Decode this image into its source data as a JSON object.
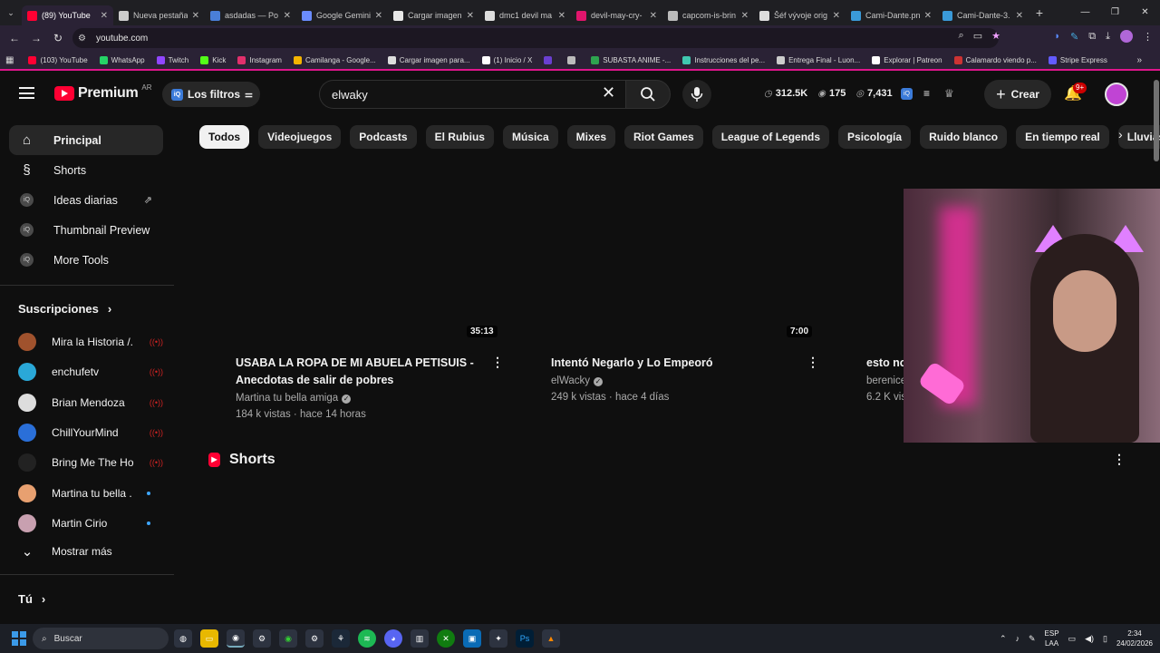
{
  "colors": {
    "brand_red": "#ff0033",
    "bg": "#0f0f0f",
    "chip_bg": "#272727",
    "accent_pink": "#e0158c",
    "link_blue": "#3ea6ff"
  },
  "browser": {
    "tabs": [
      {
        "title": "(89) YouTube",
        "icon": "youtube-icon",
        "color": "#ff0033",
        "active": true
      },
      {
        "title": "Nueva pestaña",
        "icon": "chrome-icon",
        "color": "#cccccc"
      },
      {
        "title": "asdadas — Po",
        "icon": "p-icon",
        "color": "#4a7fd8"
      },
      {
        "title": "Google Gemini",
        "icon": "gemini-icon",
        "color": "#6a8cff"
      },
      {
        "title": "Cargar imagen",
        "icon": "c-icon",
        "color": "#e8e8e8"
      },
      {
        "title": "dmc1 devil ma",
        "icon": "google-icon",
        "color": "#dddddd"
      },
      {
        "title": "devil-may-cry-",
        "icon": "fandom-icon",
        "color": "#e0156c"
      },
      {
        "title": "capcom-is-brin",
        "icon": "globe-icon",
        "color": "#bbbbbb"
      },
      {
        "title": "Šéf vývoje orig",
        "icon": "z-icon",
        "color": "#dddddd"
      },
      {
        "title": "Cami-Dante.pn",
        "icon": "image-icon",
        "color": "#3a9ad9"
      },
      {
        "title": "Cami-Dante-3.",
        "icon": "image-icon",
        "color": "#3a9ad9"
      }
    ],
    "url": "youtube.com",
    "bookmarks": [
      {
        "label": "(103) YouTube",
        "color": "#ff0033"
      },
      {
        "label": "WhatsApp",
        "color": "#25d366"
      },
      {
        "label": "Twitch",
        "color": "#9146ff"
      },
      {
        "label": "Kick",
        "color": "#53fc18"
      },
      {
        "label": "Instagram",
        "color": "#e1306c"
      },
      {
        "label": "Camilanga - Google...",
        "color": "#f4b400"
      },
      {
        "label": "Cargar imagen para...",
        "color": "#dddddd"
      },
      {
        "label": "(1) Inicio / X",
        "color": "#ffffff"
      },
      {
        "label": "",
        "color": "#6a3fd0"
      },
      {
        "label": "",
        "color": "#bbbbbb"
      },
      {
        "label": "SUBASTA ANIME -...",
        "color": "#2ea44f"
      },
      {
        "label": "Instrucciones del pe...",
        "color": "#40c8b0"
      },
      {
        "label": "Entrega Final - Luon...",
        "color": "#cccccc"
      },
      {
        "label": "Explorar | Patreon",
        "color": "#ffffff"
      },
      {
        "label": "Calamardo viendo p...",
        "color": "#cc3333"
      },
      {
        "label": "Stripe Express",
        "color": "#635bff"
      }
    ]
  },
  "youtube": {
    "logo_text": "Premium",
    "country": "AR",
    "filters_label": "Los filtros",
    "search_value": "elwaky",
    "stats": {
      "a": "312.5K",
      "b": "175",
      "c": "7,431"
    },
    "create_label": "Crear",
    "notif_badge": "9+",
    "sidebar": {
      "items": [
        {
          "label": "Principal",
          "icon": "home-icon"
        },
        {
          "label": "Shorts",
          "icon": "shorts-icon"
        },
        {
          "label": "Ideas diarias",
          "icon": "ext-icon"
        },
        {
          "label": "Thumbnail Preview",
          "icon": "ext-icon"
        },
        {
          "label": "More Tools",
          "icon": "ext-icon"
        }
      ],
      "subs_header": "Suscripciones",
      "subs": [
        {
          "name": "Mira la Historia /...",
          "status": "live",
          "color": "#a0522d"
        },
        {
          "name": "enchufetv",
          "status": "live",
          "color": "#2aa8d8"
        },
        {
          "name": "Brian Mendoza",
          "status": "live",
          "color": "#dddddd"
        },
        {
          "name": "ChillYourMind",
          "status": "live",
          "color": "#2a6fd8"
        },
        {
          "name": "Bring Me The Ho...",
          "status": "live",
          "color": "#222222"
        },
        {
          "name": "Martina tu bella ...",
          "status": "new",
          "color": "#e8a070"
        },
        {
          "name": "Martin Cirio",
          "status": "new",
          "color": "#c8a0b0"
        }
      ],
      "show_more": "Mostrar más",
      "you_header": "Tú"
    },
    "chips": [
      "Todos",
      "Videojuegos",
      "Podcasts",
      "El Rubius",
      "Música",
      "Mixes",
      "Riot Games",
      "League of Legends",
      "Psicología",
      "Ruido blanco",
      "En tiempo real",
      "Lluvias"
    ],
    "videos": [
      {
        "title1": "USABA LA ROPA DE MI ABUELA PETISUIS -",
        "title2": "Anecdotas de salir de pobres",
        "channel": "Martina tu bella amiga",
        "meta": "184 k vistas · hace 14 horas",
        "duration": "35:13"
      },
      {
        "title1": "Intentó Negarlo y Lo Empeoró",
        "title2": "",
        "channel": "elWacky",
        "meta": "249 k vistas · hace 4 días",
        "duration": "7:00"
      },
      {
        "title1": "esto no",
        "title2": "",
        "channel": "berenice",
        "meta": "6.2 K vis",
        "duration": ""
      }
    ],
    "shorts_label": "Shorts"
  },
  "taskbar": {
    "search_placeholder": "Buscar",
    "lang1": "ESP",
    "lang2": "LAA",
    "time": "2:34",
    "date": "24/02/2026"
  }
}
